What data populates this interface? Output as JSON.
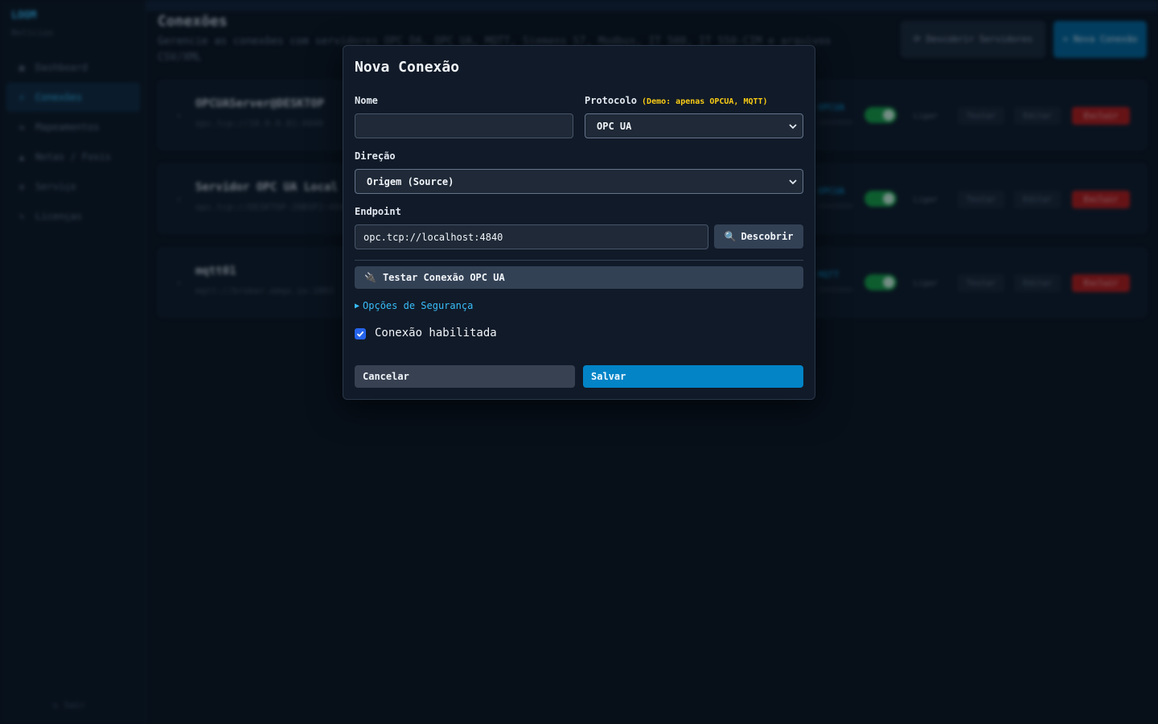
{
  "colors": {
    "accent": "#0284c7",
    "link": "#38bdf8",
    "demo_note": "#facc15",
    "danger": "#b91c1c",
    "success": "#16a34a"
  },
  "background": {
    "sidebar": {
      "brand": "LOOM",
      "brand_sub": "Notícias",
      "items": [
        {
          "icon": "dashboard-icon",
          "glyph": "▦",
          "label": "Dashboard"
        },
        {
          "icon": "plug-icon",
          "glyph": "⚡",
          "label": "Conexões",
          "active": true
        },
        {
          "icon": "chart-icon",
          "glyph": "⇆",
          "label": "Mapeamentos"
        },
        {
          "icon": "bell-icon",
          "glyph": "▲",
          "label": "Notas / Foxis"
        },
        {
          "icon": "gear-icon",
          "glyph": "⚙",
          "label": "Serviço"
        },
        {
          "icon": "key-icon",
          "glyph": "✎",
          "label": "Licenças"
        }
      ],
      "footer": "↻ Sair"
    },
    "page": {
      "title": "Conexões",
      "description": "Gerencie as conexões com servidores OPC DA, OPC UA, MQTT, Siemens S7, Modbus, IT 500, IT 550-CIM e arquivos CSV/XML",
      "discover_all_label": "⟳ Descobrir Servidores",
      "new_label": "+ Nova Conexão"
    },
    "connections": [
      {
        "name": "OPCUAServer@DESKTOP",
        "endpoint": "opc.tcp://10.0.0.81:4840",
        "tag": "OPCUA"
      },
      {
        "name": "Servidor OPC UA Local",
        "endpoint": "opc.tcp://DESKTOP-20BSPJ:4840",
        "tag": "OPCUA"
      },
      {
        "name": "mqtt01",
        "endpoint": "mqtt://broker.emqx.io:1883",
        "tag": "MQTT"
      }
    ],
    "row_actions": {
      "ligar": "Ligar",
      "testar": "Testar",
      "editar": "Editar",
      "excluir": "Excluir"
    }
  },
  "modal": {
    "title": "Nova Conexão",
    "name_label": "Nome",
    "name_value": "",
    "protocol_label": "Protocolo",
    "protocol_note": "(Demo: apenas OPCUA, MQTT)",
    "protocol_value": "OPC UA",
    "direction_label": "Direção",
    "direction_value": "Origem (Source)",
    "endpoint_label": "Endpoint",
    "endpoint_value": "opc.tcp://localhost:4840",
    "discover_label": "Descobrir",
    "test_label": "Testar Conexão OPC UA",
    "security_label": "Opções de Segurança",
    "enabled_label": "Conexão habilitada",
    "enabled": true,
    "cancel_label": "Cancelar",
    "save_label": "Salvar"
  }
}
